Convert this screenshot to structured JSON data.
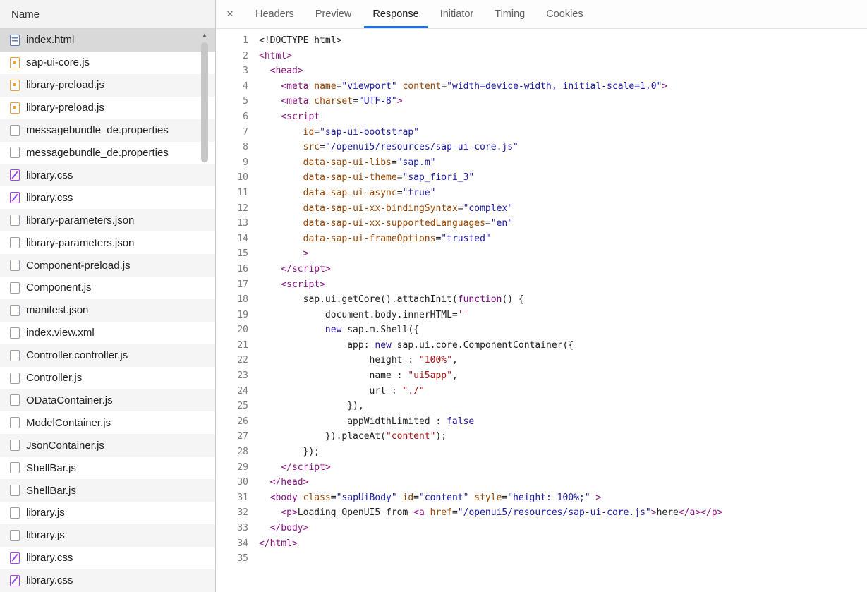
{
  "left_panel": {
    "header": "Name",
    "files": [
      {
        "name": "index.html",
        "type": "html",
        "selected": true
      },
      {
        "name": "sap-ui-core.js",
        "type": "js",
        "selected": false
      },
      {
        "name": "library-preload.js",
        "type": "js",
        "selected": false
      },
      {
        "name": "library-preload.js",
        "type": "js",
        "selected": false
      },
      {
        "name": "messagebundle_de.properties",
        "type": "plain",
        "selected": false
      },
      {
        "name": "messagebundle_de.properties",
        "type": "plain",
        "selected": false
      },
      {
        "name": "library.css",
        "type": "css",
        "selected": false
      },
      {
        "name": "library.css",
        "type": "css",
        "selected": false
      },
      {
        "name": "library-parameters.json",
        "type": "plain",
        "selected": false
      },
      {
        "name": "library-parameters.json",
        "type": "plain",
        "selected": false
      },
      {
        "name": "Component-preload.js",
        "type": "plain",
        "selected": false
      },
      {
        "name": "Component.js",
        "type": "plain",
        "selected": false
      },
      {
        "name": "manifest.json",
        "type": "plain",
        "selected": false
      },
      {
        "name": "index.view.xml",
        "type": "plain",
        "selected": false
      },
      {
        "name": "Controller.controller.js",
        "type": "plain",
        "selected": false
      },
      {
        "name": "Controller.js",
        "type": "plain",
        "selected": false
      },
      {
        "name": "ODataContainer.js",
        "type": "plain",
        "selected": false
      },
      {
        "name": "ModelContainer.js",
        "type": "plain",
        "selected": false
      },
      {
        "name": "JsonContainer.js",
        "type": "plain",
        "selected": false
      },
      {
        "name": "ShellBar.js",
        "type": "plain",
        "selected": false
      },
      {
        "name": "ShellBar.js",
        "type": "plain",
        "selected": false
      },
      {
        "name": "library.js",
        "type": "plain",
        "selected": false
      },
      {
        "name": "library.js",
        "type": "plain",
        "selected": false
      },
      {
        "name": "library.css",
        "type": "css",
        "selected": false
      },
      {
        "name": "library.css",
        "type": "css",
        "selected": false
      }
    ],
    "scrollbar": {
      "up_arrow": "▲"
    }
  },
  "tabs": {
    "close_label": "×",
    "items": [
      {
        "label": "Headers",
        "active": false
      },
      {
        "label": "Preview",
        "active": false
      },
      {
        "label": "Response",
        "active": true
      },
      {
        "label": "Initiator",
        "active": false
      },
      {
        "label": "Timing",
        "active": false
      },
      {
        "label": "Cookies",
        "active": false
      }
    ]
  },
  "code": {
    "lines": [
      {
        "n": 1,
        "segs": [
          [
            "p",
            "<!DOCTYPE html>"
          ]
        ]
      },
      {
        "n": 2,
        "segs": [
          [
            "t",
            "<html>"
          ]
        ]
      },
      {
        "n": 3,
        "segs": [
          [
            "p",
            "  "
          ],
          [
            "t",
            "<head>"
          ]
        ]
      },
      {
        "n": 4,
        "segs": [
          [
            "p",
            "    "
          ],
          [
            "t",
            "<meta"
          ],
          [
            "p",
            " "
          ],
          [
            "a",
            "name"
          ],
          [
            "p",
            "="
          ],
          [
            "v",
            "\"viewport\""
          ],
          [
            "p",
            " "
          ],
          [
            "a",
            "content"
          ],
          [
            "p",
            "="
          ],
          [
            "v",
            "\"width=device-width, initial-scale=1.0\""
          ],
          [
            "t",
            ">"
          ]
        ]
      },
      {
        "n": 5,
        "segs": [
          [
            "p",
            "    "
          ],
          [
            "t",
            "<meta"
          ],
          [
            "p",
            " "
          ],
          [
            "a",
            "charset"
          ],
          [
            "p",
            "="
          ],
          [
            "v",
            "\"UTF-8\""
          ],
          [
            "t",
            ">"
          ]
        ]
      },
      {
        "n": 6,
        "segs": [
          [
            "p",
            "    "
          ],
          [
            "t",
            "<script"
          ]
        ]
      },
      {
        "n": 7,
        "segs": [
          [
            "p",
            "        "
          ],
          [
            "a",
            "id"
          ],
          [
            "p",
            "="
          ],
          [
            "v",
            "\"sap-ui-bootstrap\""
          ]
        ]
      },
      {
        "n": 8,
        "segs": [
          [
            "p",
            "        "
          ],
          [
            "a",
            "src"
          ],
          [
            "p",
            "="
          ],
          [
            "v",
            "\"/openui5/resources/sap-ui-core.js\""
          ]
        ]
      },
      {
        "n": 9,
        "segs": [
          [
            "p",
            "        "
          ],
          [
            "a",
            "data-sap-ui-libs"
          ],
          [
            "p",
            "="
          ],
          [
            "v",
            "\"sap.m\""
          ]
        ]
      },
      {
        "n": 10,
        "segs": [
          [
            "p",
            "        "
          ],
          [
            "a",
            "data-sap-ui-theme"
          ],
          [
            "p",
            "="
          ],
          [
            "v",
            "\"sap_fiori_3\""
          ]
        ]
      },
      {
        "n": 11,
        "segs": [
          [
            "p",
            "        "
          ],
          [
            "a",
            "data-sap-ui-async"
          ],
          [
            "p",
            "="
          ],
          [
            "v",
            "\"true\""
          ]
        ]
      },
      {
        "n": 12,
        "segs": [
          [
            "p",
            "        "
          ],
          [
            "a",
            "data-sap-ui-xx-bindingSyntax"
          ],
          [
            "p",
            "="
          ],
          [
            "v",
            "\"complex\""
          ]
        ]
      },
      {
        "n": 13,
        "segs": [
          [
            "p",
            "        "
          ],
          [
            "a",
            "data-sap-ui-xx-supportedLanguages"
          ],
          [
            "p",
            "="
          ],
          [
            "v",
            "\"en\""
          ]
        ]
      },
      {
        "n": 14,
        "segs": [
          [
            "p",
            "        "
          ],
          [
            "a",
            "data-sap-ui-frameOptions"
          ],
          [
            "p",
            "="
          ],
          [
            "v",
            "\"trusted\""
          ]
        ]
      },
      {
        "n": 15,
        "segs": [
          [
            "p",
            "        "
          ],
          [
            "t",
            ">"
          ]
        ]
      },
      {
        "n": 16,
        "segs": [
          [
            "p",
            "    "
          ],
          [
            "t",
            "</script>"
          ]
        ]
      },
      {
        "n": 17,
        "segs": [
          [
            "p",
            "    "
          ],
          [
            "t",
            "<script>"
          ]
        ]
      },
      {
        "n": 18,
        "segs": [
          [
            "p",
            "        sap.ui.getCore().attachInit("
          ],
          [
            "k",
            "function"
          ],
          [
            "p",
            "() {"
          ]
        ]
      },
      {
        "n": 19,
        "segs": [
          [
            "p",
            "            document.body.innerHTML="
          ],
          [
            "s",
            "''"
          ]
        ]
      },
      {
        "n": 20,
        "segs": [
          [
            "p",
            "            "
          ],
          [
            "b",
            "new"
          ],
          [
            "p",
            " sap.m.Shell({"
          ]
        ]
      },
      {
        "n": 21,
        "segs": [
          [
            "p",
            "                app: "
          ],
          [
            "b",
            "new"
          ],
          [
            "p",
            " sap.ui.core.ComponentContainer({"
          ]
        ]
      },
      {
        "n": 22,
        "segs": [
          [
            "p",
            "                    height : "
          ],
          [
            "s",
            "\"100%\""
          ],
          [
            "p",
            ","
          ]
        ]
      },
      {
        "n": 23,
        "segs": [
          [
            "p",
            "                    name : "
          ],
          [
            "s",
            "\"ui5app\""
          ],
          [
            "p",
            ","
          ]
        ]
      },
      {
        "n": 24,
        "segs": [
          [
            "p",
            "                    url : "
          ],
          [
            "s",
            "\"./\""
          ]
        ]
      },
      {
        "n": 25,
        "segs": [
          [
            "p",
            "                }),"
          ]
        ]
      },
      {
        "n": 26,
        "segs": [
          [
            "p",
            "                appWidthLimited : "
          ],
          [
            "b",
            "false"
          ]
        ]
      },
      {
        "n": 27,
        "segs": [
          [
            "p",
            "            }).placeAt("
          ],
          [
            "s",
            "\"content\""
          ],
          [
            "p",
            ");"
          ]
        ]
      },
      {
        "n": 28,
        "segs": [
          [
            "p",
            "        });"
          ]
        ]
      },
      {
        "n": 29,
        "segs": [
          [
            "p",
            "    "
          ],
          [
            "t",
            "</script>"
          ]
        ]
      },
      {
        "n": 30,
        "segs": [
          [
            "p",
            "  "
          ],
          [
            "t",
            "</head>"
          ]
        ]
      },
      {
        "n": 31,
        "segs": [
          [
            "p",
            "  "
          ],
          [
            "t",
            "<body"
          ],
          [
            "p",
            " "
          ],
          [
            "a",
            "class"
          ],
          [
            "p",
            "="
          ],
          [
            "v",
            "\"sapUiBody\""
          ],
          [
            "p",
            " "
          ],
          [
            "a",
            "id"
          ],
          [
            "p",
            "="
          ],
          [
            "v",
            "\"content\""
          ],
          [
            "p",
            " "
          ],
          [
            "a",
            "style"
          ],
          [
            "p",
            "="
          ],
          [
            "v",
            "\"height: 100%;\""
          ],
          [
            "p",
            " "
          ],
          [
            "t",
            ">"
          ]
        ]
      },
      {
        "n": 32,
        "segs": [
          [
            "p",
            "    "
          ],
          [
            "t",
            "<p>"
          ],
          [
            "p",
            "Loading OpenUI5 from "
          ],
          [
            "t",
            "<a"
          ],
          [
            "p",
            " "
          ],
          [
            "a",
            "href"
          ],
          [
            "p",
            "="
          ],
          [
            "v",
            "\"/openui5/resources/sap-ui-core.js\""
          ],
          [
            "t",
            ">"
          ],
          [
            "p",
            "here"
          ],
          [
            "t",
            "</a>"
          ],
          [
            "t",
            "</p>"
          ]
        ]
      },
      {
        "n": 33,
        "segs": [
          [
            "p",
            "  "
          ],
          [
            "t",
            "</body>"
          ]
        ]
      },
      {
        "n": 34,
        "segs": [
          [
            "t",
            "</html>"
          ]
        ]
      },
      {
        "n": 35,
        "segs": []
      }
    ]
  },
  "colors": {
    "accent": "#1a73e8",
    "tab-text": "#5f6368",
    "tab-active-text": "#202124",
    "row-selected": "#d9d9d9",
    "row-stripe": "#f5f5f5",
    "icon-js": "#e8a33d",
    "icon-css": "#a142f4",
    "icon-html": "#5878b8",
    "icon-plain": "#9aa0a6",
    "tok-tag": "#881280",
    "tok-attr": "#994500",
    "tok-val": "#1a1aa6",
    "tok-kw": "#770088",
    "tok-kw2": "#221199",
    "tok-str": "#aa1111",
    "tok-plain": "#202124",
    "line-number": "#7d7d7d"
  }
}
